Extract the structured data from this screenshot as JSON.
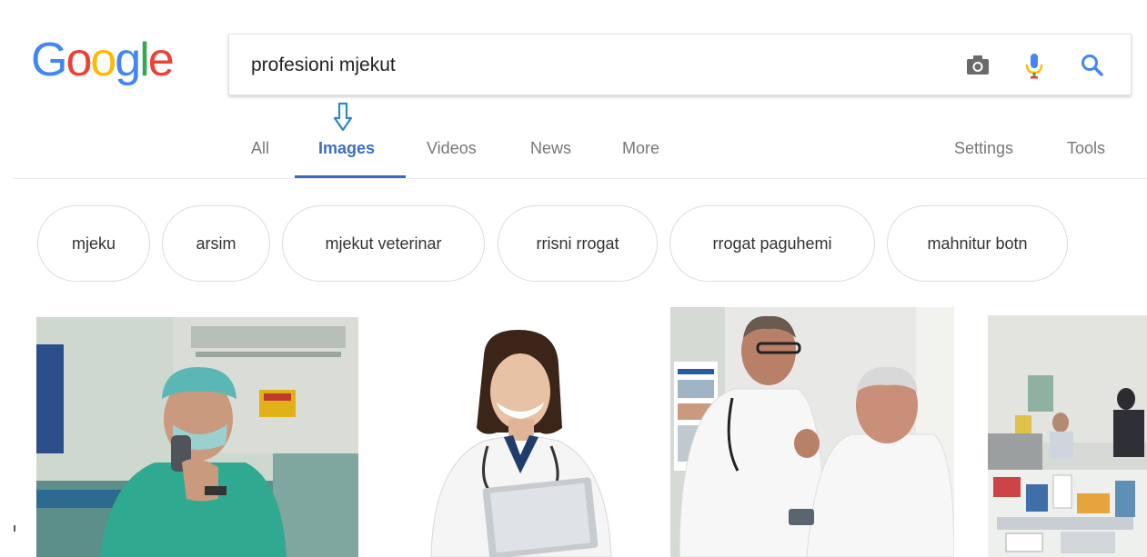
{
  "logo": {
    "letters": [
      "G",
      "o",
      "o",
      "g",
      "l",
      "e"
    ]
  },
  "search": {
    "query": "profesioni mjekut"
  },
  "icons": {
    "camera": "camera-icon",
    "mic": "microphone-icon",
    "search": "magnifier-icon",
    "arrow": "arrow-down-icon"
  },
  "tabs": {
    "all": "All",
    "images": "Images",
    "videos": "Videos",
    "news": "News",
    "more": "More",
    "settings": "Settings",
    "tools": "Tools"
  },
  "chips": [
    "mjeku",
    "arsim",
    "mjekut veterinar",
    "rrisni rrogat",
    "rrogat paguhemi",
    "mahnitur botn"
  ],
  "colors": {
    "blue": "#4285f4",
    "red": "#ea4335",
    "yellow": "#fbbc05",
    "green": "#34a853",
    "active_tab": "#3a6bbb"
  }
}
